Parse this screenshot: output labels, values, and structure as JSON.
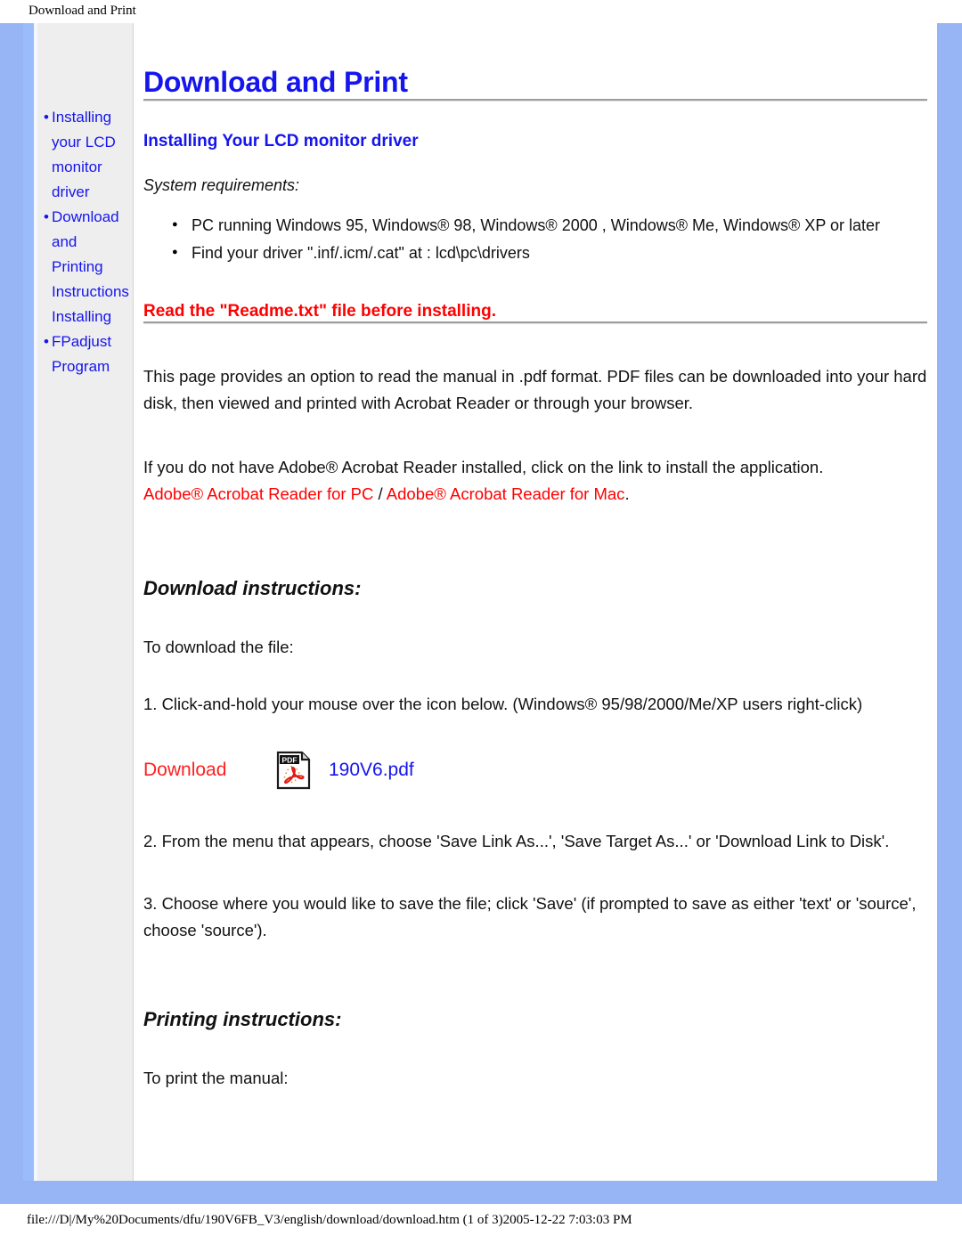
{
  "browser": {
    "print_header_title": "Download and Print",
    "footer_path": "file:///D|/My%20Documents/dfu/190V6FB_V3/english/download/download.htm (1 of 3)2005-12-22 7:03:03 PM"
  },
  "colors": {
    "frame_blue": "#97b4f5",
    "link_blue": "#1515ee",
    "warning_red": "#ff0000",
    "sidebar_gray": "#eeeeee"
  },
  "sidebar": {
    "items": [
      {
        "bullet": "•",
        "label": "Installing your LCD monitor driver"
      },
      {
        "bullet": "•",
        "label": "Download and Printing Instructions Installing"
      },
      {
        "bullet": "•",
        "label": "FPadjust Program"
      }
    ]
  },
  "main": {
    "page_title": "Download and Print",
    "section_title": "Installing Your LCD monitor driver",
    "system_requirements_label": "System requirements:",
    "requirements": [
      "PC running Windows 95, Windows® 98, Windows® 2000 , Windows® Me, Windows® XP or later",
      "Find your driver \".inf/.icm/.cat\" at : lcd\\pc\\drivers"
    ],
    "readme_warning": "Read the \"Readme.txt\" file before installing.",
    "intro_paragraph": "This page provides an option to read the manual in .pdf format. PDF files can be downloaded into your hard disk, then viewed and printed with Acrobat Reader or through your browser.",
    "acrobat_paragraph": "If you do not have Adobe® Acrobat Reader installed, click on the link to install the application.",
    "acrobat_link_pc": "Adobe® Acrobat Reader for PC",
    "acrobat_link_separator": " / ",
    "acrobat_link_mac": "Adobe® Acrobat Reader for Mac",
    "acrobat_link_period": ".",
    "download_instructions_title": "Download instructions:",
    "to_download_label": "To download the file:",
    "step_1": "1. Click-and-hold your mouse over the icon below. (Windows® 95/98/2000/Me/XP users right-click)",
    "download_word": "Download",
    "pdf_icon_label": "PDF",
    "pdf_filename": "190V6.pdf",
    "step_2": "2. From the menu that appears, choose 'Save Link As...', 'Save Target As...' or 'Download Link to Disk'.",
    "step_3": "3. Choose where you would like to save the file; click 'Save' (if prompted to save as either 'text' or 'source', choose 'source').",
    "printing_instructions_title": "Printing instructions:",
    "to_print_label": "To print the manual:"
  }
}
